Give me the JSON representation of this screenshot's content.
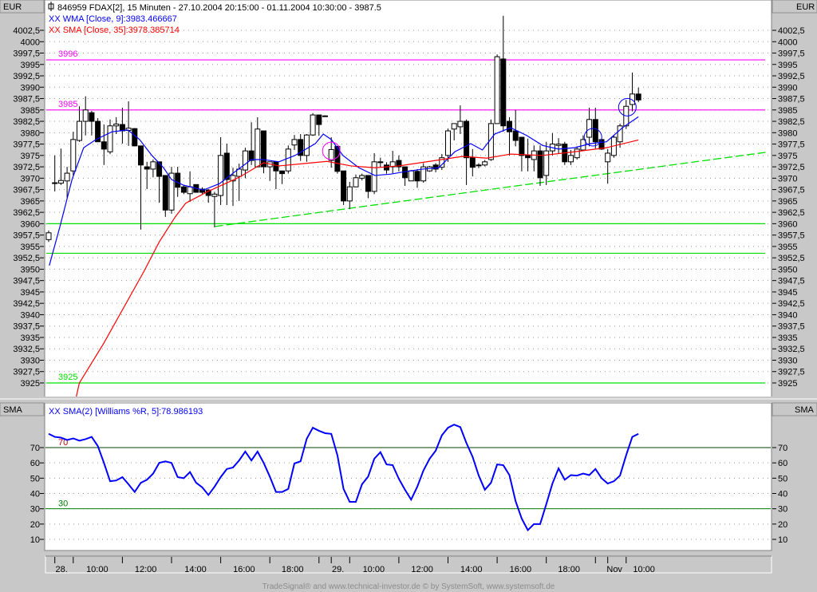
{
  "header": {
    "title": "846959  FDAX[2], 15 Minuten - 27.10.2004 20:15:00 - 01.11.2004 10:30:00 - 3987.5",
    "wma_label": "XX WMA [Close, 9]:3983.466667",
    "sma_label": "XX SMA [Close, 35]:3978.385714",
    "currency_left": "EUR",
    "currency_right": "EUR"
  },
  "indicator": {
    "title": "XX SMA(2) [Williams %R, 5]:78.986193",
    "axis_label_left": "SMA",
    "axis_label_right": "SMA"
  },
  "footer": "TradeSignal® and www.technical-investor.de © by SystemSoft, www.systemsoft.de",
  "colors": {
    "wma": "#0000ff",
    "sma": "#ff0000",
    "level": "#ff00ff",
    "support": "#00e000",
    "indicator": "#0000ff"
  },
  "chart_data": [
    {
      "type": "candlestick",
      "title": "846959  FDAX[2], 15 Minuten",
      "ylabel": "EUR",
      "ylim": [
        3922,
        4009
      ],
      "y_tick_labels": [
        "4002,5",
        "4000",
        "3997,5",
        "3995",
        "3992,5",
        "3990",
        "3987,5",
        "3985",
        "3982,5",
        "3980",
        "3977,5",
        "3975",
        "3972,5",
        "3970",
        "3967,5",
        "3965",
        "3962,5",
        "3960",
        "3957,5",
        "3955",
        "3952,5",
        "3950",
        "3947,5",
        "3945",
        "3942,5",
        "3940",
        "3937,5",
        "3935",
        "3932,5",
        "3930",
        "3927,5",
        "3925"
      ],
      "y_tick_values": [
        4002.5,
        4000,
        3997.5,
        3995,
        3992.5,
        3990,
        3987.5,
        3985,
        3982.5,
        3980,
        3977.5,
        3975,
        3972.5,
        3970,
        3967.5,
        3965,
        3962.5,
        3960,
        3957.5,
        3955,
        3952.5,
        3950,
        3947.5,
        3945,
        3942.5,
        3940,
        3937.5,
        3935,
        3932.5,
        3930,
        3927.5,
        3925
      ],
      "ohlc": [
        [
          3956.5,
          3958.5,
          3956,
          3958
        ],
        [
          3969,
          3975,
          3967.1,
          3969
        ],
        [
          3968.9,
          3976.5,
          3968.5,
          3969.5
        ],
        [
          3969.4,
          3972.5,
          3965.7,
          3971.1
        ],
        [
          3971.6,
          3980.2,
          3970.6,
          3978.5
        ],
        [
          3978.3,
          3985.8,
          3978,
          3982.5
        ],
        [
          3982.5,
          3988,
          3979.4,
          3985
        ],
        [
          3984.4,
          3984.8,
          3979.4,
          3982.5
        ],
        [
          3982.5,
          3983.2,
          3978,
          3978
        ],
        [
          3978,
          3981.8,
          3972.9,
          3976.4
        ],
        [
          3975.8,
          3982.9,
          3975.3,
          3981.5
        ],
        [
          3981.5,
          3983.4,
          3979.7,
          3981.9
        ],
        [
          3981.8,
          3985.5,
          3977.6,
          3980.4
        ],
        [
          3980.5,
          3986.9,
          3977.1,
          3981
        ],
        [
          3980.9,
          3981,
          3977,
          3977.1
        ],
        [
          3977.1,
          3977.1,
          3958.7,
          3972.9
        ],
        [
          3972.5,
          3973.6,
          3967.6,
          3972
        ],
        [
          3972,
          3974.1,
          3970.2,
          3973.6
        ],
        [
          3973.6,
          3973.6,
          3964.6,
          3970.4
        ],
        [
          3970.6,
          3970.6,
          3961.5,
          3963
        ],
        [
          3963,
          3972.5,
          3962.2,
          3971.1
        ],
        [
          3971.1,
          3972.5,
          3965.9,
          3968
        ],
        [
          3968.1,
          3968.4,
          3966.5,
          3966.9
        ],
        [
          3966.6,
          3971.5,
          3964.8,
          3968.1
        ],
        [
          3968.6,
          3968.6,
          3966.9,
          3966.9
        ],
        [
          3967.6,
          3968,
          3966.5,
          3966.9
        ],
        [
          3967.4,
          3967.6,
          3964.6,
          3966.2
        ],
        [
          3966,
          3967,
          3959.2,
          3966.5
        ],
        [
          3966.2,
          3979,
          3964.1,
          3975
        ],
        [
          3975.5,
          3977.6,
          3964.1,
          3969.7
        ],
        [
          3969.4,
          3972.3,
          3963.9,
          3970.6
        ],
        [
          3970.4,
          3973.2,
          3965,
          3972
        ],
        [
          3971.8,
          3976.7,
          3970,
          3976
        ],
        [
          3976,
          3982.3,
          3972.9,
          3973.9
        ],
        [
          3972.5,
          3983.4,
          3972.4,
          3980.8
        ],
        [
          3980.4,
          3980.4,
          3971.1,
          3972.5
        ],
        [
          3972.5,
          3973.6,
          3969.4,
          3973.6
        ],
        [
          3973.6,
          3973.6,
          3967.6,
          3971.6
        ],
        [
          3971.6,
          3971.6,
          3968.7,
          3971
        ],
        [
          3971.6,
          3977.2,
          3971,
          3976.4
        ],
        [
          3977.3,
          3979.5,
          3976.2,
          3978.5
        ],
        [
          3978.5,
          3979.7,
          3973.8,
          3975
        ],
        [
          3975,
          3979.7,
          3973.6,
          3979.5
        ],
        [
          3979.5,
          3984.3,
          3979.3,
          3983.9
        ],
        [
          3983.9,
          3983.9,
          3979.3,
          3981.8
        ],
        [
          3983.7,
          3983.8,
          3983.6,
          3983.7
        ],
        [
          3973.9,
          3979,
          3972.3,
          3976.3
        ],
        [
          3977,
          3977,
          3971,
          3971.5
        ],
        [
          3971.6,
          3971.6,
          3964.1,
          3965
        ],
        [
          3965,
          3969.2,
          3963.2,
          3968.1
        ],
        [
          3968.1,
          3970.8,
          3968,
          3970.1
        ],
        [
          3970,
          3971,
          3969.5,
          3970.6
        ],
        [
          3970.6,
          3970.6,
          3965.6,
          3967.1
        ],
        [
          3967.1,
          3975.5,
          3966.5,
          3973.6
        ],
        [
          3973.6,
          3974.5,
          3972.5,
          3973.6
        ],
        [
          3972.9,
          3973.5,
          3971,
          3971.8
        ],
        [
          3972.5,
          3976,
          3971.1,
          3973.6
        ],
        [
          3973.9,
          3975,
          3971.5,
          3972.5
        ],
        [
          3972.5,
          3972.5,
          3968.3,
          3970.1
        ],
        [
          3969.4,
          3971.8,
          3969.4,
          3971.6
        ],
        [
          3971.5,
          3972,
          3967.9,
          3969.4
        ],
        [
          3969.4,
          3973.3,
          3969,
          3972.5
        ],
        [
          3971.6,
          3972.7,
          3971.4,
          3972.5
        ],
        [
          3972.9,
          3973.3,
          3971.3,
          3972
        ],
        [
          3972.4,
          3975.3,
          3971.8,
          3974.5
        ],
        [
          3975,
          3980.9,
          3973.6,
          3980.4
        ],
        [
          3980.8,
          3982,
          3978.3,
          3982
        ],
        [
          3981.3,
          3986,
          3979.7,
          3982.5
        ],
        [
          3982.5,
          3982.9,
          3968.5,
          3974.5
        ],
        [
          3974.5,
          3976.4,
          3970.4,
          3972.4
        ],
        [
          3972.9,
          3973.3,
          3972.2,
          3972.9
        ],
        [
          3972.9,
          3974,
          3972.6,
          3973.6
        ],
        [
          3974.1,
          3982.9,
          3973.8,
          3982
        ],
        [
          3982,
          3997.2,
          3982,
          3996.7
        ],
        [
          3996.2,
          4005.7,
          3980.2,
          3981.5
        ],
        [
          3982.5,
          3983.4,
          3975,
          3980.2
        ],
        [
          3980.4,
          3985,
          3977,
          3978.3
        ],
        [
          3979,
          3979,
          3971.5,
          3975
        ],
        [
          3975,
          3978.7,
          3971.5,
          3974.5
        ],
        [
          3974.1,
          3977.2,
          3971.5,
          3976
        ],
        [
          3976,
          3977.2,
          3968.3,
          3970.1
        ],
        [
          3970.6,
          3978,
          3968.5,
          3976
        ],
        [
          3976,
          3979.9,
          3975,
          3977.5
        ],
        [
          3977.2,
          3978.8,
          3975.4,
          3977.5
        ],
        [
          3977.5,
          3978,
          3972.9,
          3973.6
        ],
        [
          3973.6,
          3976.2,
          3972.9,
          3975
        ],
        [
          3974.5,
          3977,
          3974.1,
          3976.4
        ],
        [
          3976.2,
          3979.4,
          3976.2,
          3978.5
        ],
        [
          3979,
          3985.5,
          3977,
          3982.9
        ],
        [
          3982.9,
          3985.5,
          3976.5,
          3978
        ],
        [
          3978.5,
          3978.6,
          3976.2,
          3976.4
        ],
        [
          3973.6,
          3976.4,
          3968.8,
          3975.5
        ],
        [
          3975,
          3979.4,
          3974.5,
          3979
        ],
        [
          3978,
          3982,
          3976.7,
          3981.5
        ],
        [
          3981.5,
          3987.2,
          3980.8,
          3985.8
        ],
        [
          3986.2,
          3993.2,
          3984.7,
          3988.5
        ],
        [
          3988.5,
          3989.9,
          3986.7,
          3987.2
        ]
      ],
      "series": [
        {
          "name": "WMA [Close, 9]",
          "points": [
            [
              0.1,
              3950.8
            ],
            [
              1.8,
              3959.2
            ],
            [
              3.8,
              3969.7
            ],
            [
              5.7,
              3976.7
            ],
            [
              7.7,
              3978.5
            ],
            [
              10.3,
              3980.2
            ],
            [
              12.9,
              3980.6
            ],
            [
              14.8,
              3978.5
            ],
            [
              16.8,
              3975
            ],
            [
              18.7,
              3972.3
            ],
            [
              20,
              3969.7
            ],
            [
              21.9,
              3968.5
            ],
            [
              25.2,
              3967.4
            ],
            [
              27.8,
              3968.8
            ],
            [
              30.4,
              3971.5
            ],
            [
              33,
              3974.1
            ],
            [
              34.9,
              3974.1
            ],
            [
              37.5,
              3973.6
            ],
            [
              40.1,
              3975
            ],
            [
              43.4,
              3977.6
            ],
            [
              44.7,
              3979.7
            ],
            [
              46,
              3978.5
            ],
            [
              47.9,
              3975
            ],
            [
              50.5,
              3972.3
            ],
            [
              53.1,
              3970.6
            ],
            [
              55.7,
              3970.9
            ],
            [
              58.3,
              3971.5
            ],
            [
              60.9,
              3972
            ],
            [
              63.5,
              3972.3
            ],
            [
              66.1,
              3975.8
            ],
            [
              68.7,
              3977.6
            ],
            [
              70.6,
              3976.2
            ],
            [
              72.6,
              3979.7
            ],
            [
              75.2,
              3981.1
            ],
            [
              77.8,
              3979.4
            ],
            [
              80.4,
              3977.2
            ],
            [
              83,
              3976.4
            ],
            [
              85.6,
              3976.7
            ],
            [
              88.2,
              3977.6
            ],
            [
              90.8,
              3978
            ],
            [
              93.4,
              3981.1
            ],
            [
              96,
              3983.5
            ]
          ]
        },
        {
          "name": "SMA [Close, 35]",
          "points": [
            [
              4.5,
              3921
            ],
            [
              5,
              3925
            ],
            [
              9,
              3933.8
            ],
            [
              15.5,
              3949.5
            ],
            [
              18,
              3956
            ],
            [
              20.6,
              3961.5
            ],
            [
              22.3,
              3964.5
            ],
            [
              25.8,
              3967
            ],
            [
              31,
              3970.2
            ],
            [
              35,
              3973.4
            ],
            [
              37.5,
              3972.7
            ],
            [
              41.4,
              3973.2
            ],
            [
              45.3,
              3973.7
            ],
            [
              49.2,
              3972.7
            ],
            [
              53.1,
              3972.3
            ],
            [
              57,
              3972.7
            ],
            [
              62,
              3973.7
            ],
            [
              67.4,
              3974.8
            ],
            [
              71.3,
              3974.4
            ],
            [
              75.2,
              3975.3
            ],
            [
              80.4,
              3975
            ],
            [
              85.6,
              3975.8
            ],
            [
              90.8,
              3976.7
            ],
            [
              96,
              3978.4
            ]
          ]
        }
      ],
      "horizontal_levels": [
        {
          "value": 3996,
          "label": "3996",
          "color": "#ff00ff"
        },
        {
          "value": 3985,
          "label": "3985",
          "color": "#ff00ff"
        },
        {
          "value": 3960,
          "label": "",
          "color": "#00e000"
        },
        {
          "value": 3953.5,
          "label": "",
          "color": "#00e000"
        },
        {
          "value": 3925,
          "label": "3925",
          "color": "#00e000"
        }
      ],
      "trendline": {
        "from": [
          27.1,
          3959.4
        ],
        "to": [
          116.8,
          3975.7
        ],
        "color": "#00e000"
      },
      "markers": [
        {
          "bar": 46,
          "value": 3976,
          "color": "#ff00ff"
        },
        {
          "bar": 88.6,
          "value": 3979,
          "color": "#0000ff"
        },
        {
          "bar": 94.2,
          "value": 3985.6,
          "color": "#0000ff"
        }
      ]
    },
    {
      "type": "line",
      "title": "XX SMA(2) [Williams %R, 5]",
      "ylim": [
        -0.5,
        96
      ],
      "y_tick_labels": [
        "70",
        "60",
        "50",
        "40",
        "30",
        "20",
        "10"
      ],
      "y_tick_values": [
        70,
        60,
        50,
        40,
        30,
        20,
        10
      ],
      "levels": [
        {
          "value": 70,
          "label": "70",
          "color": "#004000",
          "label_color": "#c00000"
        },
        {
          "value": 30,
          "label": "30",
          "color": "#008000",
          "label_color": "#008000"
        }
      ],
      "values": [
        79,
        77,
        76.5,
        75,
        76,
        74.5,
        75.5,
        77,
        71,
        60,
        48,
        48.5,
        50.7,
        46,
        41,
        47,
        49,
        53,
        60,
        61,
        60,
        50.7,
        50,
        54,
        47,
        44,
        39,
        44.4,
        50.7,
        56,
        57,
        61.6,
        67.4,
        61.6,
        67.4,
        60,
        51,
        41,
        41,
        43,
        59.6,
        61,
        75.7,
        83,
        81,
        79.4,
        79,
        65,
        43,
        34.5,
        34.5,
        46,
        51,
        62.7,
        67,
        59,
        58.5,
        49.6,
        42.4,
        36,
        44.4,
        55,
        62.7,
        68,
        78,
        83,
        85,
        83.4,
        73,
        64,
        51.7,
        42.4,
        47,
        59,
        58.5,
        52,
        35,
        23.6,
        16,
        20,
        20,
        33,
        46.5,
        56.4,
        49,
        52,
        51.7,
        53,
        52,
        56,
        50,
        46.5,
        48,
        51.7,
        65,
        77,
        79
      ]
    }
  ],
  "x_axis": {
    "labels": [
      {
        "text": "28.",
        "bar": 2.1
      },
      {
        "text": "10:00",
        "bar": 7.9
      },
      {
        "text": "12:00",
        "bar": 15.8
      },
      {
        "text": "14:00",
        "bar": 23.9
      },
      {
        "text": "16:00",
        "bar": 31.8
      },
      {
        "text": "18:00",
        "bar": 39.7
      },
      {
        "text": "29.",
        "bar": 47.1
      },
      {
        "text": "10:00",
        "bar": 52.9
      },
      {
        "text": "12:00",
        "bar": 60.8
      },
      {
        "text": "14:00",
        "bar": 68.8
      },
      {
        "text": "16:00",
        "bar": 76.8
      },
      {
        "text": "18:00",
        "bar": 84.7
      },
      {
        "text": "Nov",
        "bar": 92.1
      },
      {
        "text": "10:00",
        "bar": 96.9
      }
    ],
    "tick_bars": [
      1,
      4,
      12,
      20,
      28,
      36,
      44,
      46,
      49,
      57,
      65,
      73,
      81,
      89,
      91,
      94
    ]
  }
}
